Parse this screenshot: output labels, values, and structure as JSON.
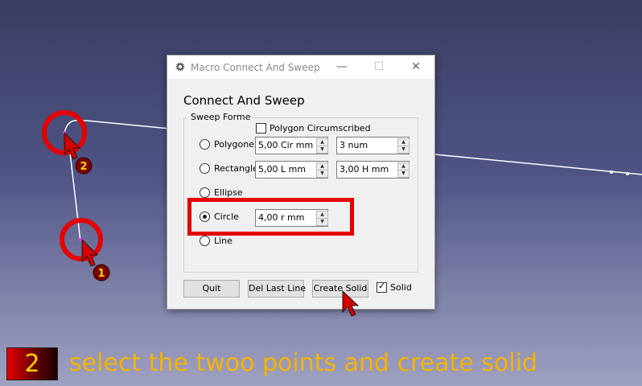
{
  "window": {
    "title": "Macro Connect And Sweep",
    "minimize_label": "—",
    "maximize_label": "☐",
    "close_label": "✕"
  },
  "dialog": {
    "heading": "Connect And Sweep",
    "group_title": "Sweep Forme",
    "polygon_circumscribed_label": "Polygon Circumscribed",
    "polygon_circumscribed_checked": false,
    "options": {
      "polygone": {
        "label": "Polygone",
        "selected": false,
        "value1": "5,00 Cir mm",
        "value2": "3 num"
      },
      "rectangle": {
        "label": "Rectangle",
        "selected": false,
        "value1": "5,00 L mm",
        "value2": "3,00 H mm"
      },
      "ellipse": {
        "label": "Ellipse",
        "selected": false
      },
      "circle": {
        "label": "Circle",
        "selected": true,
        "value1": "4,00 r mm"
      },
      "line": {
        "label": "Line",
        "selected": false
      }
    },
    "buttons": {
      "quit": "Quit",
      "del_last_line": "Del Last Line",
      "create_solid": "Create Solid"
    },
    "solid_label": "Solid",
    "solid_checked": true
  },
  "markers": {
    "first": "1",
    "second": "2"
  },
  "banner": {
    "step": "2",
    "text": "select the twoo points and create solid"
  },
  "colors": {
    "highlight": "#e60000",
    "banner_text": "#f5b200",
    "step_number": "#ffd400"
  }
}
